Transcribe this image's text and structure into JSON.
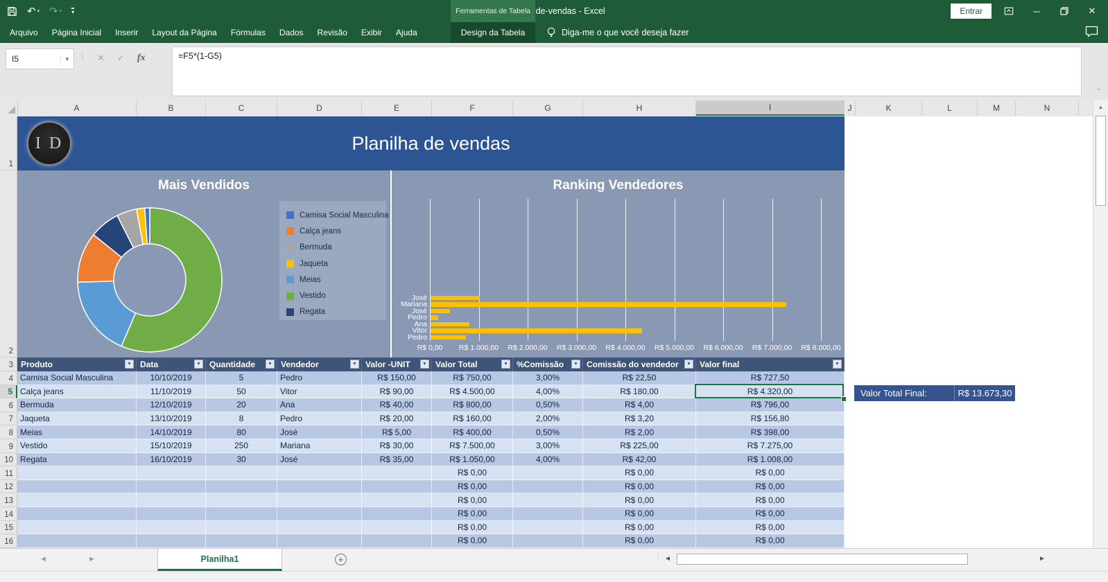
{
  "titlebar": {
    "title": "planilha-de-vendas - Excel",
    "contextual_group": "Ferramentas de Tabela",
    "signin": "Entrar",
    "qat_icons": [
      "save-icon",
      "undo-icon",
      "redo-icon",
      "customize-quick-access-icon"
    ],
    "window_icons": [
      "ribbon-display-options-icon",
      "minimize-icon",
      "restore-icon",
      "close-icon"
    ]
  },
  "ribbon": {
    "tabs": [
      "Arquivo",
      "Página Inicial",
      "Inserir",
      "Layout da Página",
      "Fórmulas",
      "Dados",
      "Revisão",
      "Exibir",
      "Ajuda"
    ],
    "contextual_tab": "Design da Tabela",
    "tellme": "Diga-me o que você deseja fazer",
    "tellme_icon": "lightbulb-icon",
    "right_icon": "comment-icon"
  },
  "formula_bar": {
    "name_box": "I5",
    "formula": "=F5*(1-G5)"
  },
  "grid": {
    "columns": [
      "A",
      "B",
      "C",
      "D",
      "E",
      "F",
      "G",
      "H",
      "I",
      "J",
      "K",
      "L",
      "M",
      "N"
    ],
    "rows": [
      "1",
      "2",
      "3",
      "4",
      "5",
      "6",
      "7",
      "8",
      "9",
      "10",
      "11",
      "12",
      "13",
      "14",
      "15",
      "16"
    ],
    "selected_cell": "I5",
    "selected_column": "I",
    "selected_row": "5"
  },
  "banner": {
    "logo": "I D",
    "title": "Planilha de vendas"
  },
  "chart_data": [
    {
      "type": "pie",
      "donut": true,
      "title": "Mais Vendidos",
      "legend_position": "right",
      "series": [
        {
          "name": "Camisa Social Masculina",
          "value": 5,
          "color": "#4472C4"
        },
        {
          "name": "Calça jeans",
          "value": 50,
          "color": "#ED7D31"
        },
        {
          "name": "Bermuda",
          "value": 20,
          "color": "#A6A6A6"
        },
        {
          "name": "Jaqueta",
          "value": 8,
          "color": "#FFC000"
        },
        {
          "name": "Meias",
          "value": 80,
          "color": "#5B9BD5"
        },
        {
          "name": "Vestido",
          "value": 250,
          "color": "#70AD47"
        },
        {
          "name": "Regata",
          "value": 30,
          "color": "#264478"
        }
      ],
      "plot_order": [
        "Vestido",
        "Meias",
        "Calça jeans",
        "Regata",
        "Bermuda",
        "Jaqueta",
        "Camisa Social Masculina"
      ],
      "slice_labels_shown": [
        "Vestido",
        "Meias",
        "Regata",
        "Bermuda"
      ]
    },
    {
      "type": "bar",
      "orientation": "horizontal",
      "title": "Ranking Vendedores",
      "categories": [
        "José",
        "Mariana",
        "José",
        "Pedro",
        "Ana",
        "Vitor",
        "Pedro"
      ],
      "values": [
        1008,
        7275,
        398,
        156.8,
        796,
        4320,
        727.5
      ],
      "bar_color": "#FFC000",
      "xlim": [
        0,
        8000
      ],
      "x_ticks": [
        "R$ 0,00",
        "R$ 1.000,00",
        "R$ 2.000,00",
        "R$ 3.000,00",
        "R$ 4.000,00",
        "R$ 5.000,00",
        "R$ 6.000,00",
        "R$ 7.000,00",
        "R$ 8.000,00"
      ],
      "gridlines": true,
      "legend": "none"
    }
  ],
  "table": {
    "headers": [
      "Produto",
      "Data",
      "Quantidade",
      "Vendedor",
      "Valor -UNIT",
      "Valor Total",
      "%Comissão",
      "Comissão do vendedor",
      "Valor final"
    ],
    "rows": [
      [
        "Camisa Social Masculina",
        "10/10/2019",
        "5",
        "Pedro",
        "R$ 150,00",
        "R$ 750,00",
        "3,00%",
        "R$ 22,50",
        "R$ 727,50"
      ],
      [
        "Calça jeans",
        "11/10/2019",
        "50",
        "Vitor",
        "R$ 90,00",
        "R$ 4.500,00",
        "4,00%",
        "R$ 180,00",
        "R$ 4.320,00"
      ],
      [
        "Bermuda",
        "12/10/2019",
        "20",
        "Ana",
        "R$ 40,00",
        "R$ 800,00",
        "0,50%",
        "R$ 4,00",
        "R$ 796,00"
      ],
      [
        "Jaqueta",
        "13/10/2019",
        "8",
        "Pedro",
        "R$ 20,00",
        "R$ 160,00",
        "2,00%",
        "R$ 3,20",
        "R$ 156,80"
      ],
      [
        "Meias",
        "14/10/2019",
        "80",
        "José",
        "R$ 5,00",
        "R$ 400,00",
        "0,50%",
        "R$ 2,00",
        "R$ 398,00"
      ],
      [
        "Vestido",
        "15/10/2019",
        "250",
        "Mariana",
        "R$ 30,00",
        "R$ 7.500,00",
        "3,00%",
        "R$ 225,00",
        "R$ 7.275,00"
      ],
      [
        "Regata",
        "16/10/2019",
        "30",
        "José",
        "R$ 35,00",
        "R$ 1.050,00",
        "4,00%",
        "R$ 42,00",
        "R$ 1.008,00"
      ],
      [
        "",
        "",
        "",
        "",
        "",
        "R$ 0,00",
        "",
        "R$ 0,00",
        "R$ 0,00"
      ],
      [
        "",
        "",
        "",
        "",
        "",
        "R$ 0,00",
        "",
        "R$ 0,00",
        "R$ 0,00"
      ],
      [
        "",
        "",
        "",
        "",
        "",
        "R$ 0,00",
        "",
        "R$ 0,00",
        "R$ 0,00"
      ],
      [
        "",
        "",
        "",
        "",
        "",
        "R$ 0,00",
        "",
        "R$ 0,00",
        "R$ 0,00"
      ],
      [
        "",
        "",
        "",
        "",
        "",
        "R$ 0,00",
        "",
        "R$ 0,00",
        "R$ 0,00"
      ],
      [
        "",
        "",
        "",
        "",
        "",
        "R$ 0,00",
        "",
        "R$ 0,00",
        "R$ 0,00"
      ]
    ]
  },
  "summary": {
    "label": "Valor Total Final:",
    "value": "R$ 13.673,30"
  },
  "sheet_tabs": {
    "active": "Planilha1"
  },
  "colors": {
    "accent_green": "#217346",
    "banner_blue": "#2D5493",
    "table_header_blue": "#3E5577",
    "band_dark": "#B7C7E4",
    "band_light": "#D6E1F1",
    "chart_panel": "#8A99B3",
    "bar_yellow": "#FFC000"
  }
}
